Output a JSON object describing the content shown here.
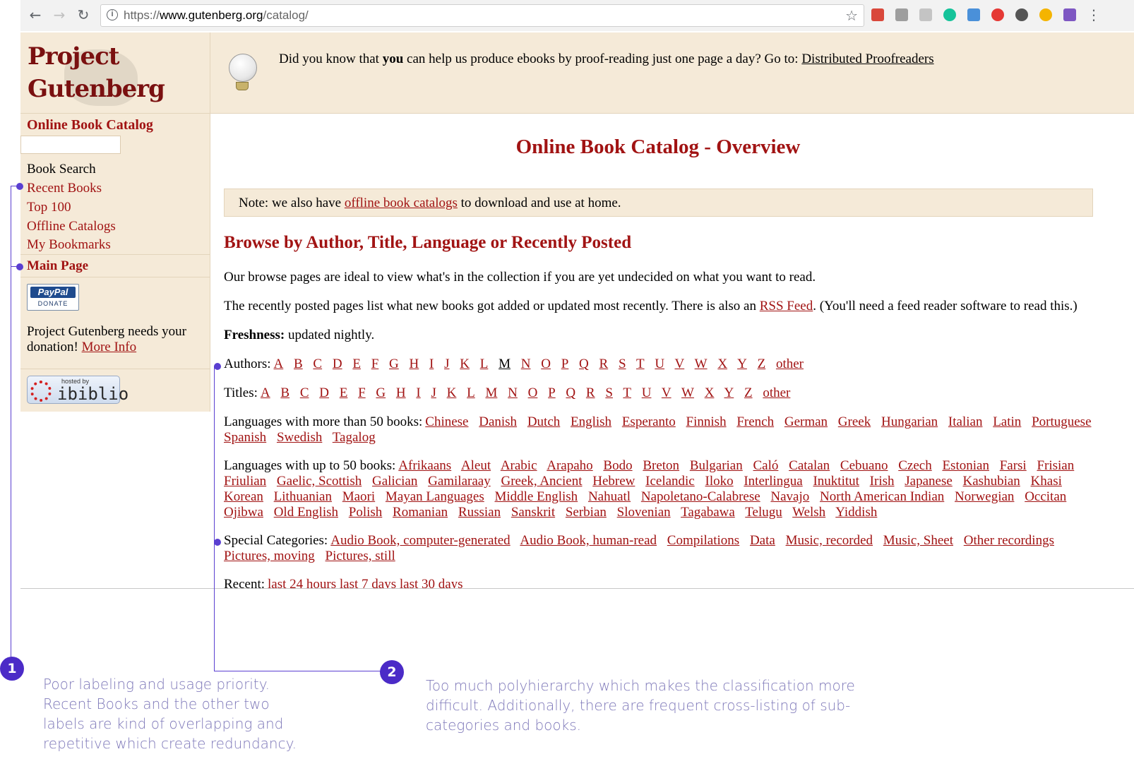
{
  "browser": {
    "url_scheme": "https://",
    "url_host": "www.gutenberg.org",
    "url_path": "/catalog/",
    "back": "←",
    "forward": "→",
    "reload": "↻",
    "star": "☆",
    "menu": "⋮",
    "extension_colors": [
      "#d9483b",
      "#9e9e9e",
      "#c4c4c4",
      "#15c39a",
      "#4a90d9",
      "#e53935",
      "#555555",
      "#f4b400",
      "#7e57c2"
    ]
  },
  "sidebar": {
    "logo_line1": "Project",
    "logo_line2": "Gutenberg",
    "catalog_title": "Online Book Catalog",
    "book_search": "Book Search",
    "recent_books": "Recent Books",
    "top_100": "Top 100",
    "offline_catalogs": "Offline Catalogs",
    "my_bookmarks": "My Bookmarks",
    "main_page": "Main Page",
    "paypal_label": "PayPal",
    "paypal_donate": "DONATE",
    "donation_text": "Project Gutenberg needs your donation!",
    "more_info": "More Info",
    "ibiblio_hosted": "hosted by",
    "ibiblio_name": "ibiblio"
  },
  "tip": {
    "text_before": "Did you know that ",
    "text_bold": "you",
    "text_after": " can help us produce ebooks by proof-reading just one page a day? Go to: ",
    "link": "Distributed Proofreaders"
  },
  "main": {
    "title": "Online Book Catalog - Overview",
    "note_before": "Note: we also have ",
    "note_link": "offline book catalogs",
    "note_after": " to download and use at home.",
    "browse_heading": "Browse by Author, Title, Language or Recently Posted",
    "para1": "Our browse pages are ideal to view what's in the collection if you are yet undecided on what you want to read.",
    "para2_before": "The recently posted pages list what new books got added or updated most recently. There is also an ",
    "para2_link": "RSS Feed",
    "para2_after": ". (You'll need a feed reader software to read this.)",
    "freshness_label": "Freshness:",
    "freshness_value": " updated nightly.",
    "authors_label": "Authors:",
    "authors_current": "M",
    "authors_letters": [
      "A",
      "B",
      "C",
      "D",
      "E",
      "F",
      "G",
      "H",
      "I",
      "J",
      "K",
      "L",
      "M",
      "N",
      "O",
      "P",
      "Q",
      "R",
      "S",
      "T",
      "U",
      "V",
      "W",
      "X",
      "Y",
      "Z",
      "other"
    ],
    "titles_label": "Titles:",
    "titles_letters": [
      "A",
      "B",
      "C",
      "D",
      "E",
      "F",
      "G",
      "H",
      "I",
      "J",
      "K",
      "L",
      "M",
      "N",
      "O",
      "P",
      "Q",
      "R",
      "S",
      "T",
      "U",
      "V",
      "W",
      "X",
      "Y",
      "Z",
      "other"
    ],
    "lang50_label": "Languages with more than 50 books:",
    "lang50": [
      "Chinese",
      "Danish",
      "Dutch",
      "English",
      "Esperanto",
      "Finnish",
      "French",
      "German",
      "Greek",
      "Hungarian",
      "Italian",
      "Latin",
      "Portuguese",
      "Spanish",
      "Swedish",
      "Tagalog"
    ],
    "langfew_label": "Languages with up to 50 books:",
    "langfew": [
      "Afrikaans",
      "Aleut",
      "Arabic",
      "Arapaho",
      "Bodo",
      "Breton",
      "Bulgarian",
      "Caló",
      "Catalan",
      "Cebuano",
      "Czech",
      "Estonian",
      "Farsi",
      "Frisian",
      "Friulian",
      "Gaelic, Scottish",
      "Galician",
      "Gamilaraay",
      "Greek, Ancient",
      "Hebrew",
      "Icelandic",
      "Iloko",
      "Interlingua",
      "Inuktitut",
      "Irish",
      "Japanese",
      "Kashubian",
      "Khasi",
      "Korean",
      "Lithuanian",
      "Maori",
      "Mayan Languages",
      "Middle English",
      "Nahuatl",
      "Napoletano-Calabrese",
      "Navajo",
      "North American Indian",
      "Norwegian",
      "Occitan",
      "Ojibwa",
      "Old English",
      "Polish",
      "Romanian",
      "Russian",
      "Sanskrit",
      "Serbian",
      "Slovenian",
      "Tagabawa",
      "Telugu",
      "Welsh",
      "Yiddish"
    ],
    "special_label": "Special Categories:",
    "special": [
      "Audio Book, computer-generated",
      "Audio Book, human-read",
      "Compilations",
      "Data",
      "Music, recorded",
      "Music, Sheet",
      "Other recordings",
      "Pictures, moving",
      "Pictures, still"
    ],
    "recent_label": "Recent:",
    "recent": [
      "last 24 hours",
      "last 7 days",
      "last 30 days"
    ]
  },
  "annotations": {
    "accent_color": "#5a3fd1",
    "num1": "1",
    "num2": "2",
    "text1": "Poor labeling and usage priority. Recent Books and the other two labels are kind of overlapping and repetitive which create redundancy.",
    "text2": "Too much polyhierarchy which makes the classification more difficult. Additionally, there are frequent cross-listing of sub-categories and books."
  }
}
